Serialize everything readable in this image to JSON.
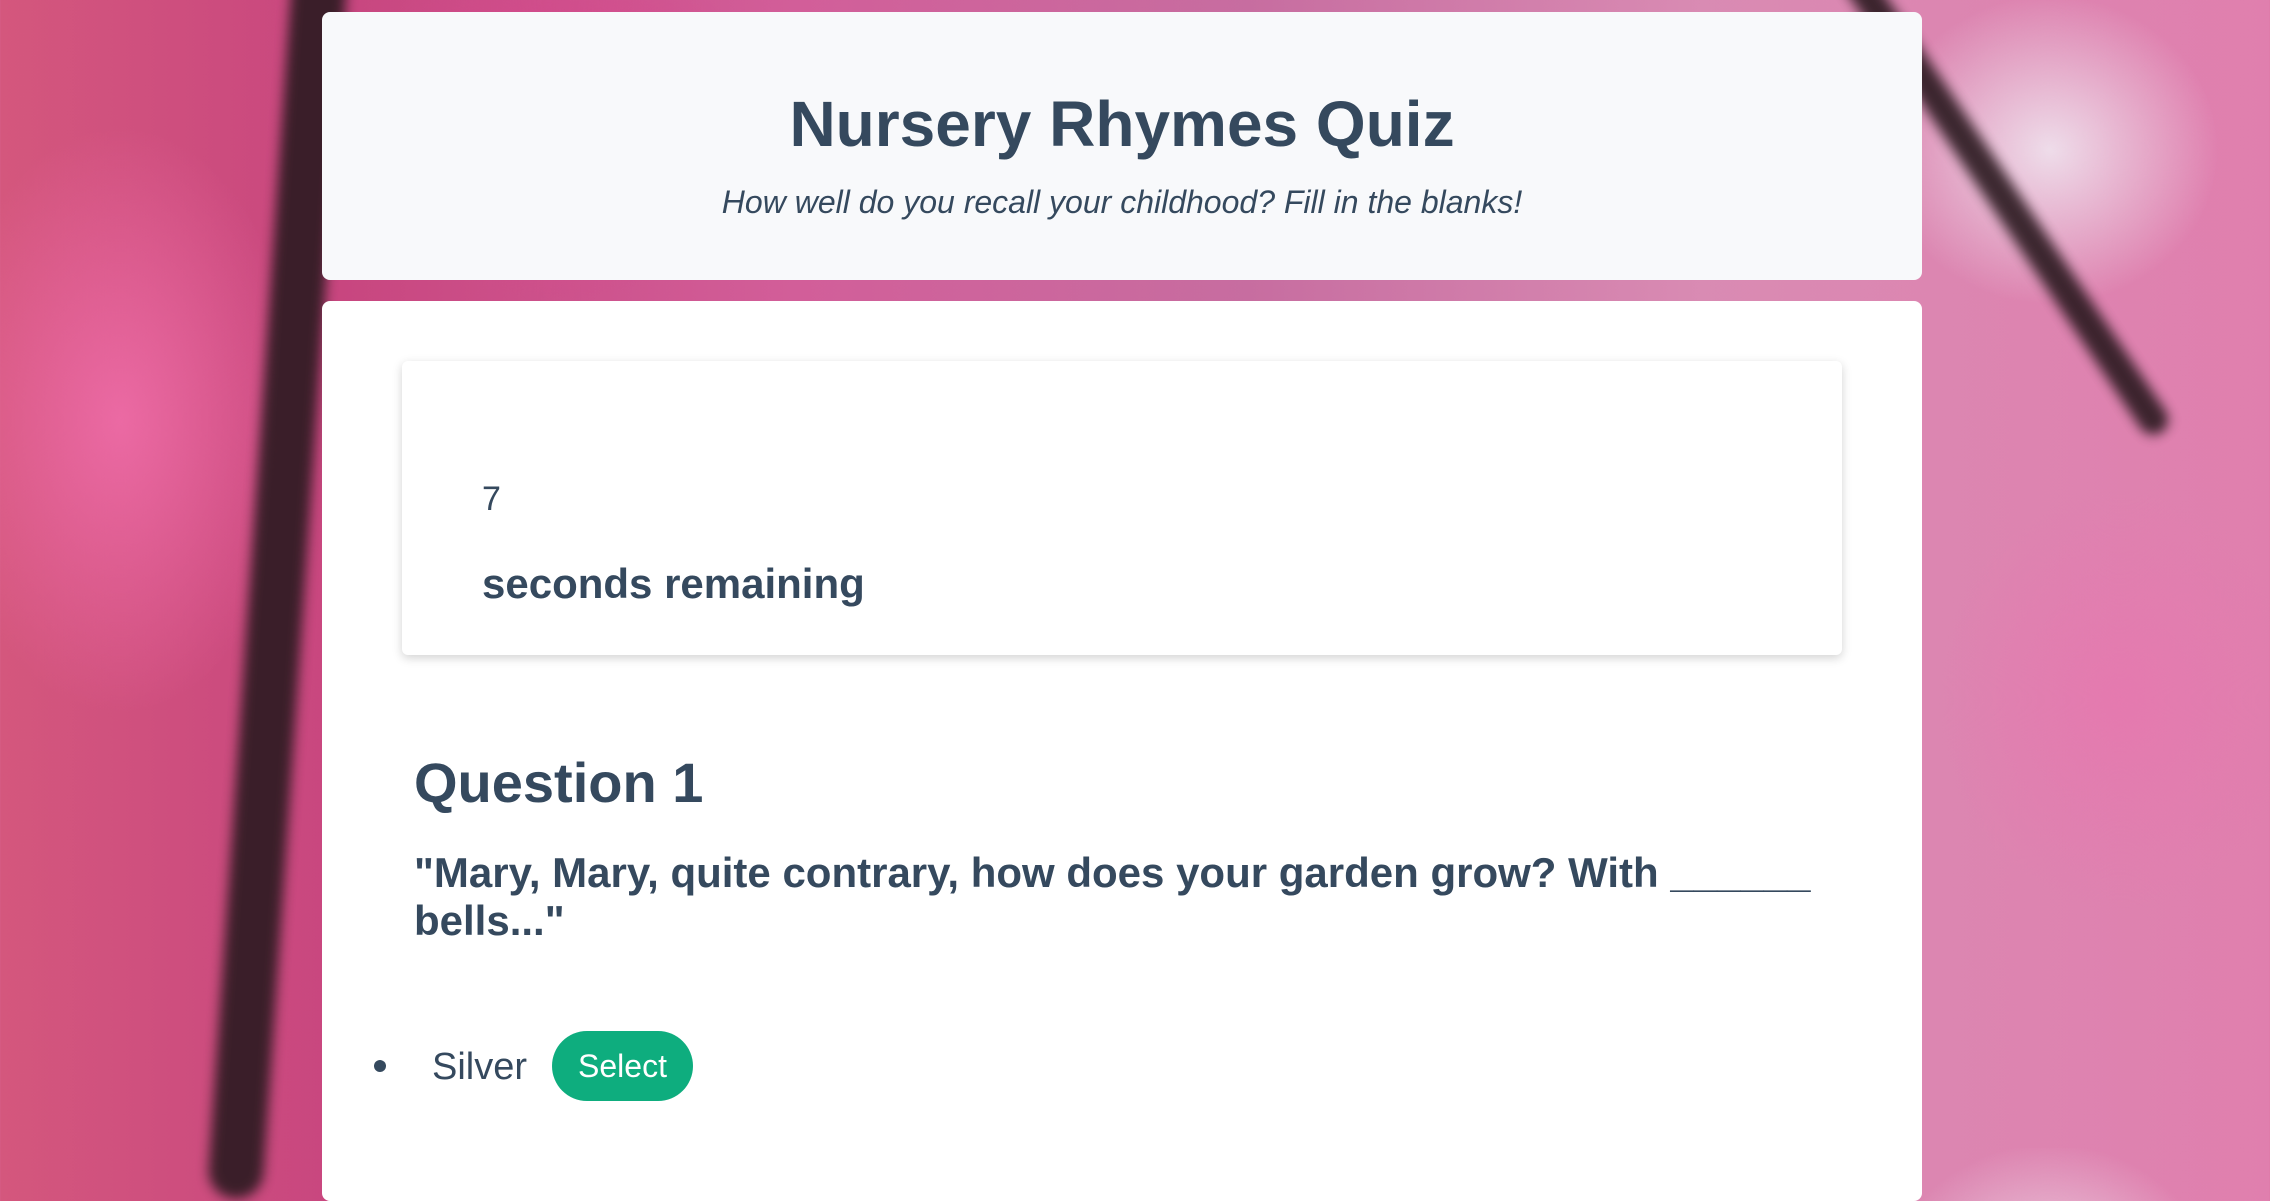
{
  "header": {
    "title": "Nursery Rhymes Quiz",
    "subtitle": "How well do you recall your childhood? Fill in the blanks!"
  },
  "timer": {
    "count": "7",
    "label": "seconds remaining"
  },
  "question": {
    "heading": "Question 1",
    "text": "\"Mary, Mary, quite contrary, how does your garden grow? With ______ bells...\"",
    "options": [
      {
        "label": "Silver",
        "button": "Select"
      }
    ]
  },
  "colors": {
    "text": "#35495e",
    "accent": "#0ead7e",
    "header_bg": "#f8f9fb",
    "card_bg": "#ffffff"
  }
}
